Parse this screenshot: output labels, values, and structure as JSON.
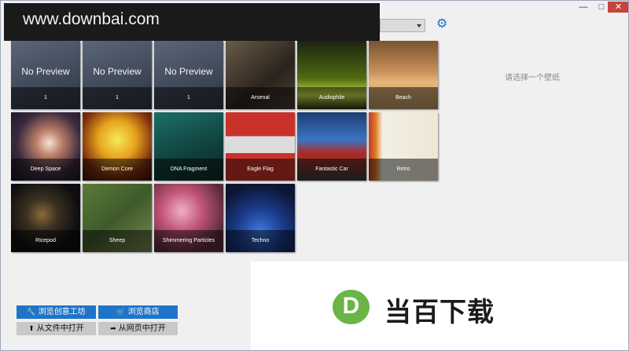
{
  "watermark": "www.downbai.com",
  "window_controls": {
    "minimize": "—",
    "maximize": "□",
    "close": "✕"
  },
  "settings_icon": "gear-icon",
  "wallpapers": [
    {
      "label": "1",
      "placeholder": "No Preview"
    },
    {
      "label": "1",
      "placeholder": "No Preview"
    },
    {
      "label": "1",
      "placeholder": "No Preview"
    },
    {
      "label": "Arsenal"
    },
    {
      "label": "Audiophile"
    },
    {
      "label": "Beach"
    },
    {
      "label": "Deep Space"
    },
    {
      "label": "Demon Core"
    },
    {
      "label": "DNA Fragment"
    },
    {
      "label": "Eagle Flag"
    },
    {
      "label": "Fantastic Car"
    },
    {
      "label": "Retro"
    },
    {
      "label": "Ricepod"
    },
    {
      "label": "Sheep"
    },
    {
      "label": "Shimmering Particles"
    },
    {
      "label": "Techno"
    }
  ],
  "preview_hint": "请选择一个壁纸",
  "buttons": {
    "browse_workshop": "浏览创意工坊",
    "browse_store": "浏览商店",
    "open_from_file": "从文件中打开",
    "open_from_web": "从网页中打开"
  },
  "ad": {
    "brand": "当百下载",
    "logo_letter": "D"
  },
  "colors": {
    "accent": "#1f74c8",
    "ad_green": "#6ab547"
  }
}
